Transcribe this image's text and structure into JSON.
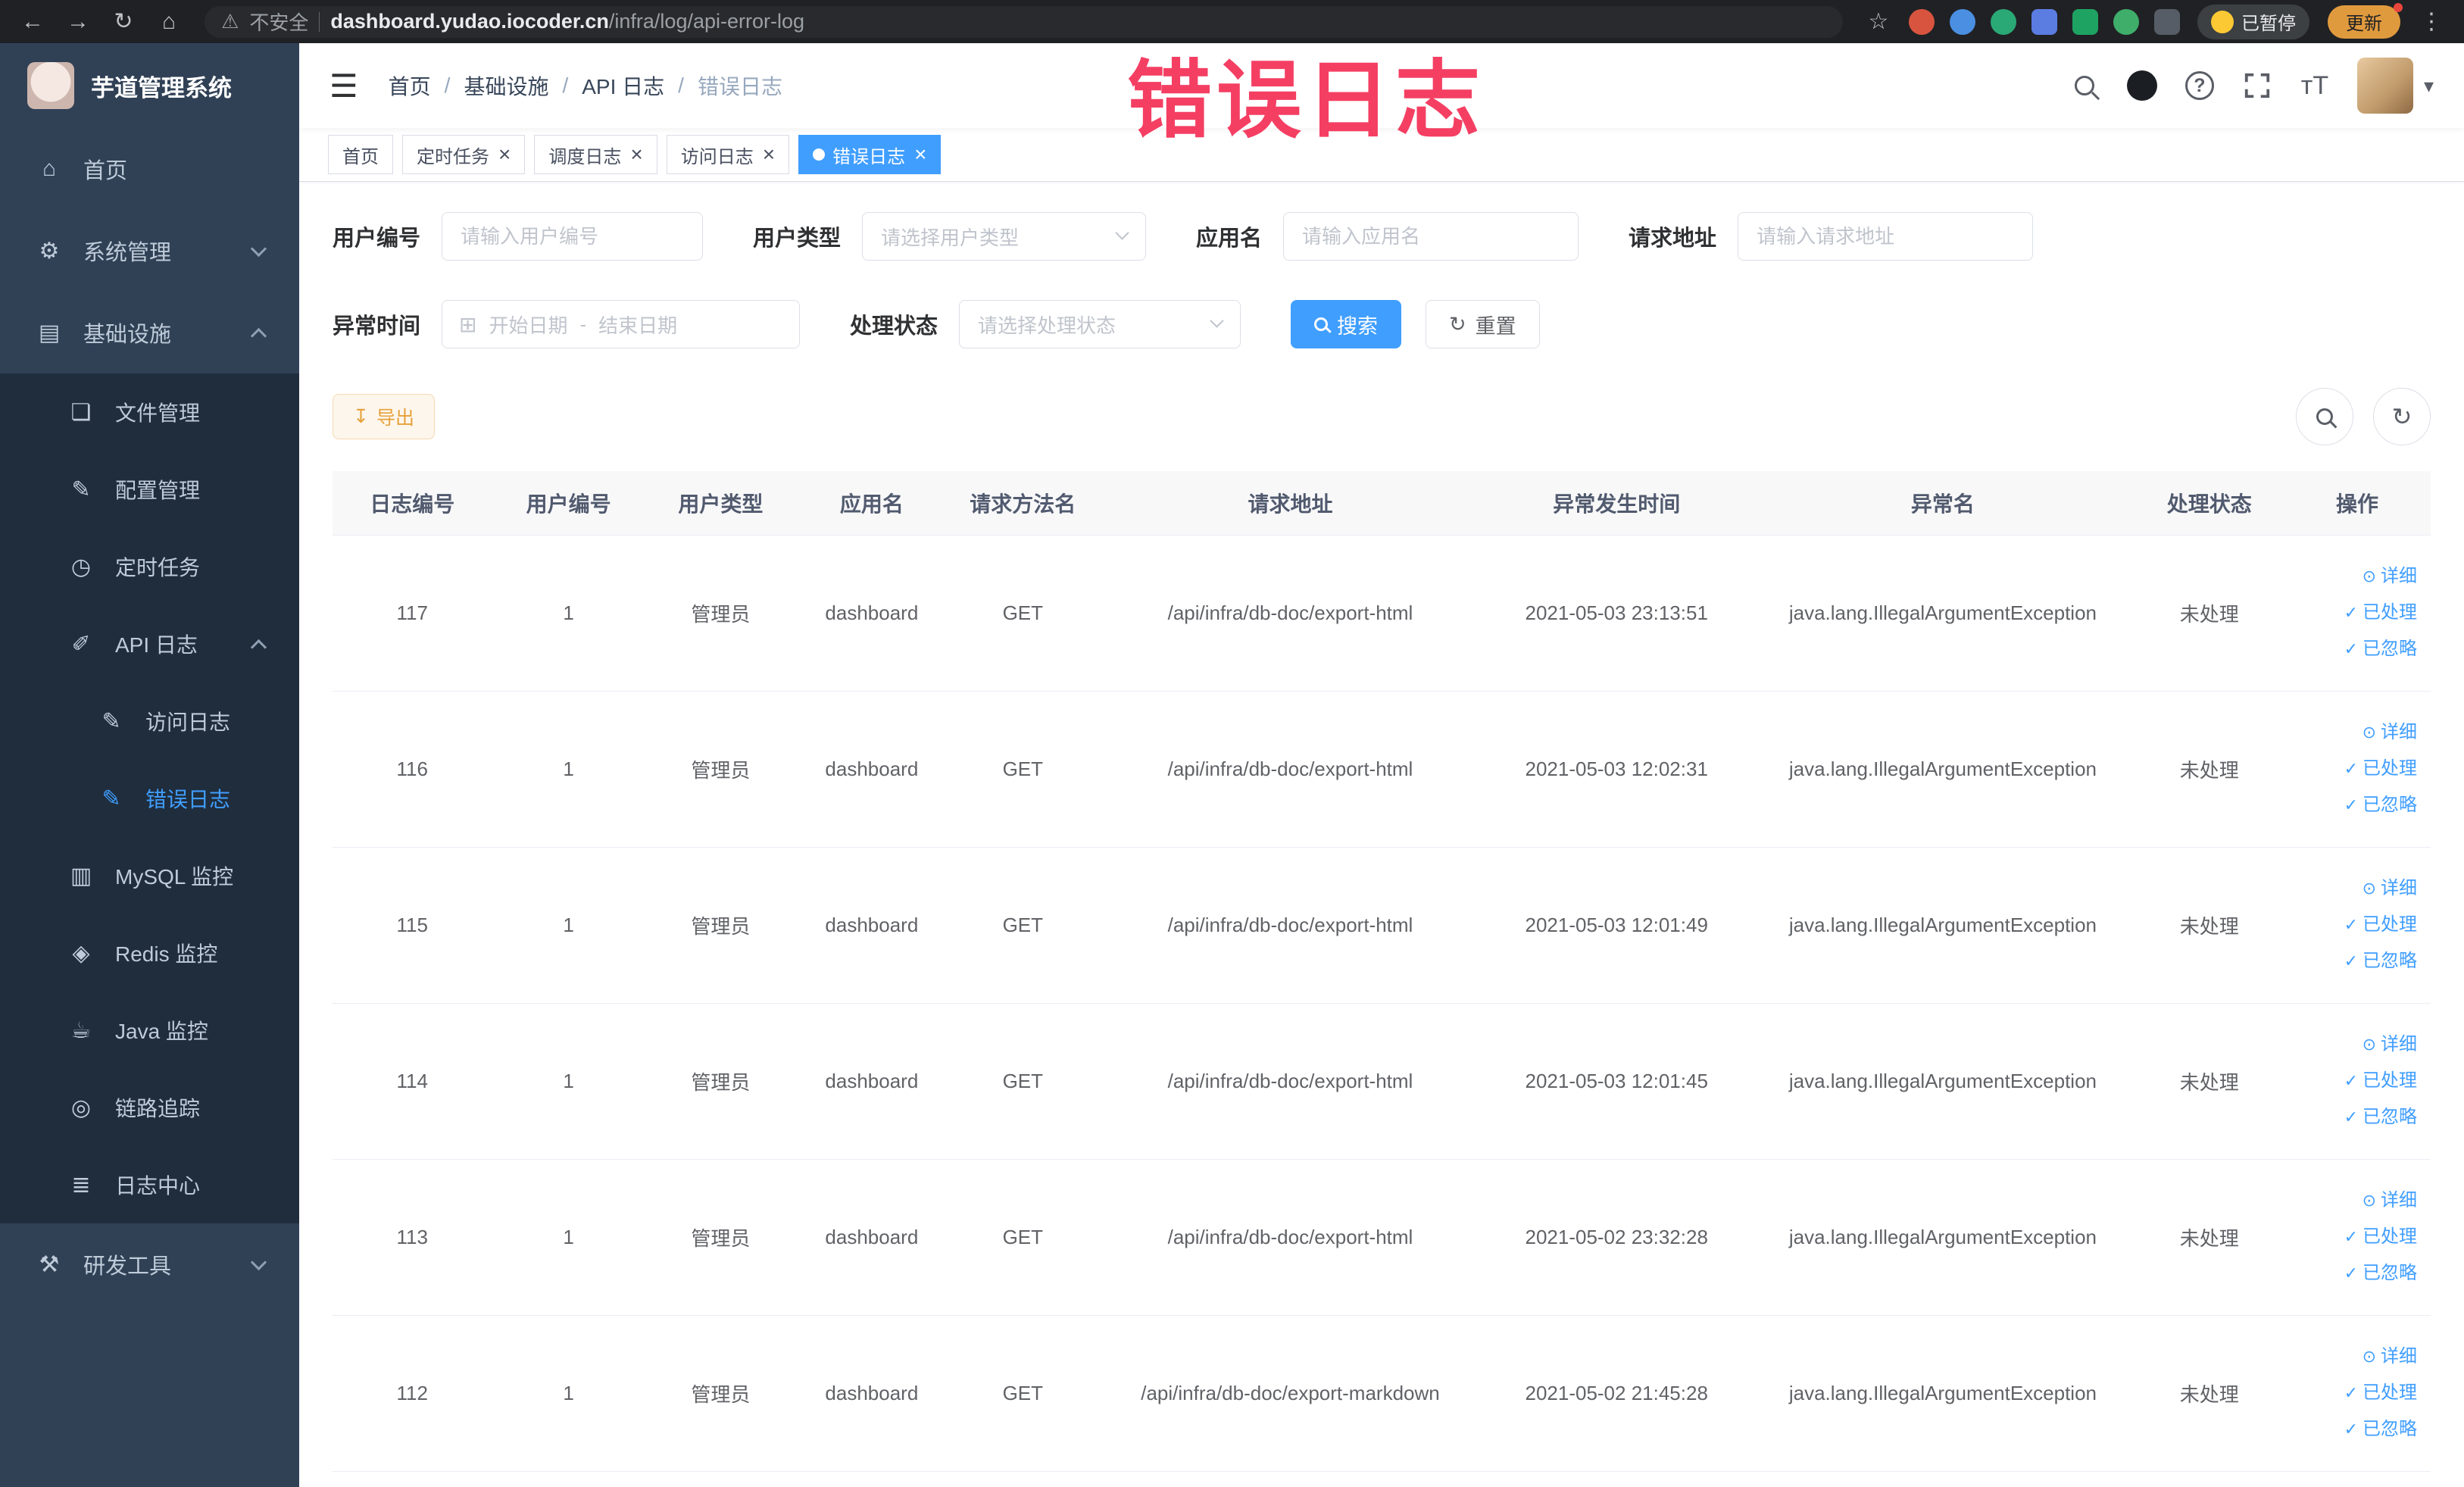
{
  "icons": {
    "back": "←",
    "forward": "→",
    "reload": "↻",
    "home_browser": "⌂",
    "warning": "⚠",
    "star": "☆",
    "more": "⋮",
    "hamburger": "☰",
    "home": "⌂",
    "system": "⚙",
    "infra": "▤",
    "file": "❏",
    "config": "✎",
    "job": "◷",
    "apilog": "✐",
    "accesslog": "✎",
    "errorlog": "✎",
    "mysql": "▥",
    "redis": "◈",
    "java": "☕",
    "trace": "◎",
    "logcenter": "≣",
    "devtools": "⚒",
    "calendar": "⊞",
    "download": "↧",
    "refresh": "↻",
    "eye": "⊙",
    "check": "✓",
    "close": "×",
    "caret": "▾",
    "fontsize": "тT"
  },
  "browser": {
    "security_label": "不安全",
    "url_domain": "dashboard.yudao.iocoder.cn",
    "url_path": "/infra/log/api-error-log",
    "paused_badge": "已暂停",
    "update_button": "更新"
  },
  "sidebar": {
    "logo_title": "芋道管理系统",
    "items": [
      {
        "key": "home",
        "icon": "home",
        "label": "首页",
        "level": 0,
        "sub": false
      },
      {
        "key": "system",
        "icon": "system",
        "label": "系统管理",
        "level": 0,
        "sub": false,
        "chevron": "down"
      },
      {
        "key": "infra",
        "icon": "infra",
        "label": "基础设施",
        "level": 0,
        "sub": false,
        "chevron": "up"
      },
      {
        "key": "file",
        "icon": "file",
        "label": "文件管理",
        "level": 1,
        "sub": true
      },
      {
        "key": "config",
        "icon": "config",
        "label": "配置管理",
        "level": 1,
        "sub": true
      },
      {
        "key": "job",
        "icon": "job",
        "label": "定时任务",
        "level": 1,
        "sub": true
      },
      {
        "key": "apilog",
        "icon": "apilog",
        "label": "API 日志",
        "level": 1,
        "sub": true,
        "chevron": "up"
      },
      {
        "key": "accesslog",
        "icon": "accesslog",
        "label": "访问日志",
        "level": 2,
        "sub": true
      },
      {
        "key": "errorlog",
        "icon": "errorlog",
        "label": "错误日志",
        "level": 2,
        "sub": true,
        "active": true
      },
      {
        "key": "mysql",
        "icon": "mysql",
        "label": "MySQL 监控",
        "level": 1,
        "sub": true
      },
      {
        "key": "redis",
        "icon": "redis",
        "label": "Redis 监控",
        "level": 1,
        "sub": true
      },
      {
        "key": "java",
        "icon": "java",
        "label": "Java 监控",
        "level": 1,
        "sub": true
      },
      {
        "key": "trace",
        "icon": "trace",
        "label": "链路追踪",
        "level": 1,
        "sub": true
      },
      {
        "key": "logcenter",
        "icon": "logcenter",
        "label": "日志中心",
        "level": 1,
        "sub": true
      },
      {
        "key": "devtools",
        "icon": "devtools",
        "label": "研发工具",
        "level": 0,
        "sub": false,
        "chevron": "down"
      }
    ]
  },
  "header": {
    "breadcrumb": [
      "首页",
      "基础设施",
      "API 日志",
      "错误日志"
    ],
    "breadcrumb_separator": "/"
  },
  "tabs": [
    {
      "label": "首页",
      "closable": false,
      "active": false
    },
    {
      "label": "定时任务",
      "closable": true,
      "active": false
    },
    {
      "label": "调度日志",
      "closable": true,
      "active": false
    },
    {
      "label": "访问日志",
      "closable": true,
      "active": false
    },
    {
      "label": "错误日志",
      "closable": true,
      "active": true
    }
  ],
  "watermark": "错误日志",
  "filters": {
    "user_id": {
      "label": "用户编号",
      "placeholder": "请输入用户编号"
    },
    "user_type": {
      "label": "用户类型",
      "placeholder": "请选择用户类型"
    },
    "app_name": {
      "label": "应用名",
      "placeholder": "请输入应用名"
    },
    "request_url": {
      "label": "请求地址",
      "placeholder": "请输入请求地址"
    },
    "exception_time": {
      "label": "异常时间",
      "start_placeholder": "开始日期",
      "separator": "-",
      "end_placeholder": "结束日期"
    },
    "process_status": {
      "label": "处理状态",
      "placeholder": "请选择处理状态"
    },
    "search_button": "搜索",
    "reset_button": "重置"
  },
  "toolbar": {
    "export_button": "导出"
  },
  "table": {
    "columns": [
      "日志编号",
      "用户编号",
      "用户类型",
      "应用名",
      "请求方法名",
      "请求地址",
      "异常发生时间",
      "异常名",
      "处理状态",
      "操作"
    ],
    "actions": [
      {
        "key": "detail",
        "icon": "eye",
        "label": "详细"
      },
      {
        "key": "process",
        "icon": "check",
        "label": "已处理"
      },
      {
        "key": "ignore",
        "icon": "check",
        "label": "已忽略"
      }
    ],
    "rows": [
      {
        "id": "117",
        "user_id": "1",
        "user_type": "管理员",
        "app": "dashboard",
        "method": "GET",
        "url": "/api/infra/db-doc/export-html",
        "time": "2021-05-03 23:13:51",
        "exception": "java.lang.IllegalArgumentException",
        "status": "未处理"
      },
      {
        "id": "116",
        "user_id": "1",
        "user_type": "管理员",
        "app": "dashboard",
        "method": "GET",
        "url": "/api/infra/db-doc/export-html",
        "time": "2021-05-03 12:02:31",
        "exception": "java.lang.IllegalArgumentException",
        "status": "未处理"
      },
      {
        "id": "115",
        "user_id": "1",
        "user_type": "管理员",
        "app": "dashboard",
        "method": "GET",
        "url": "/api/infra/db-doc/export-html",
        "time": "2021-05-03 12:01:49",
        "exception": "java.lang.IllegalArgumentException",
        "status": "未处理"
      },
      {
        "id": "114",
        "user_id": "1",
        "user_type": "管理员",
        "app": "dashboard",
        "method": "GET",
        "url": "/api/infra/db-doc/export-html",
        "time": "2021-05-03 12:01:45",
        "exception": "java.lang.IllegalArgumentException",
        "status": "未处理"
      },
      {
        "id": "113",
        "user_id": "1",
        "user_type": "管理员",
        "app": "dashboard",
        "method": "GET",
        "url": "/api/infra/db-doc/export-html",
        "time": "2021-05-02 23:32:28",
        "exception": "java.lang.IllegalArgumentException",
        "status": "未处理"
      },
      {
        "id": "112",
        "user_id": "1",
        "user_type": "管理员",
        "app": "dashboard",
        "method": "GET",
        "url": "/api/infra/db-doc/export-markdown",
        "time": "2021-05-02 21:45:28",
        "exception": "java.lang.IllegalArgumentException",
        "status": "未处理"
      }
    ]
  }
}
